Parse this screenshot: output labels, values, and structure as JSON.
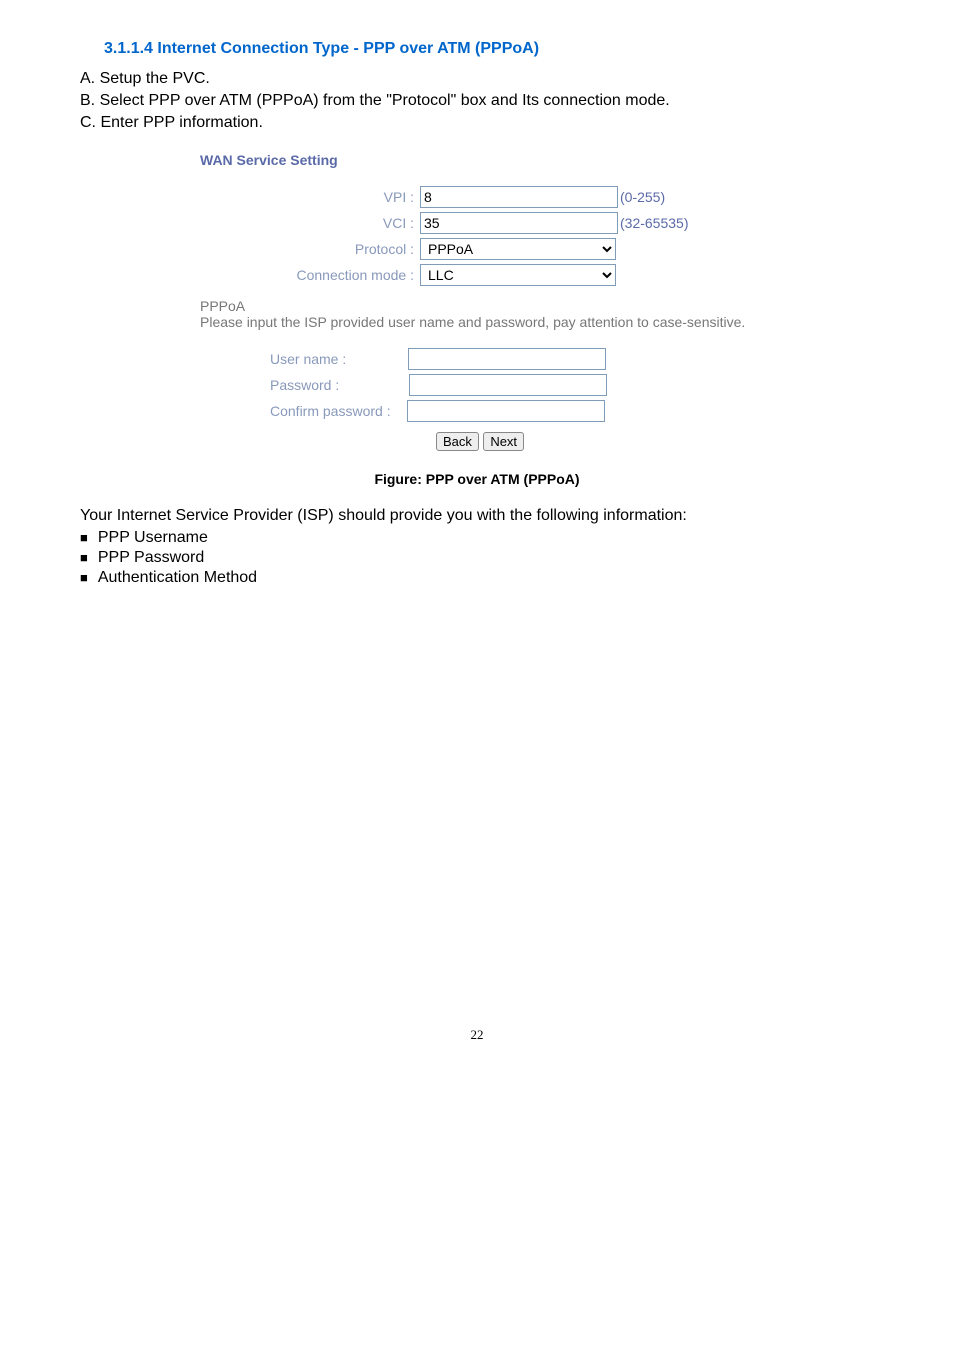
{
  "heading": "3.1.1.4 Internet Connection Type - PPP over ATM (PPPoA)",
  "steps": {
    "a": "A. Setup the PVC.",
    "b": "B. Select PPP over ATM (PPPoA) from the \"Protocol\" box and Its connection mode.",
    "c": "C. Enter PPP information."
  },
  "wan": {
    "title": "WAN Service Setting",
    "vpi": {
      "label": "VPI :",
      "value": "8",
      "hint": "(0-255)"
    },
    "vci": {
      "label": "VCI :",
      "value": "35",
      "hint": "(32-65535)"
    },
    "protocol": {
      "label": "Protocol :",
      "value": "PPPoA"
    },
    "conn": {
      "label": "Connection mode :",
      "value": "LLC"
    }
  },
  "pppoa": {
    "title": "PPPoA",
    "note": "Please input the ISP provided user name and password, pay attention to case-sensitive.",
    "user": {
      "label": "User name :",
      "value": ""
    },
    "pass": {
      "label": "Password :",
      "value": ""
    },
    "confirm": {
      "label": "Confirm password :",
      "value": ""
    }
  },
  "buttons": {
    "back": "Back",
    "next": "Next"
  },
  "figure_caption": "Figure: PPP over ATM (PPPoA)",
  "info_line": "Your Internet Service Provider (ISP) should provide you with the following information:",
  "bullets": {
    "b0": "PPP Username",
    "b1": "PPP Password",
    "b2": "Authentication Method"
  },
  "page_number": "22"
}
